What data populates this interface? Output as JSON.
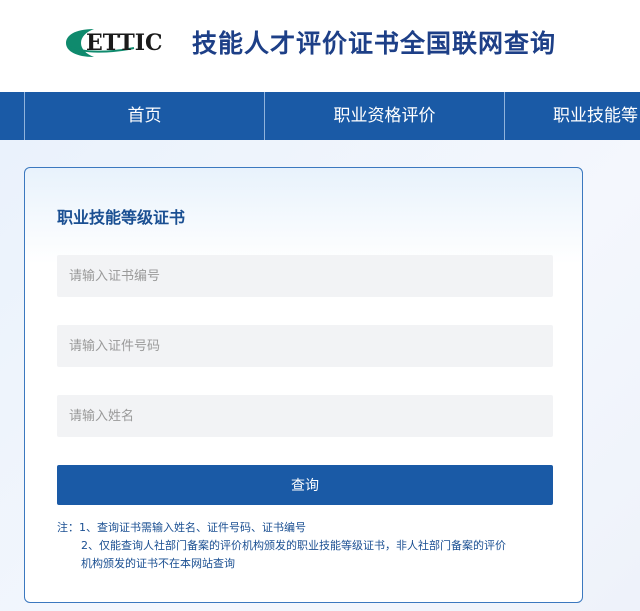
{
  "header": {
    "logo_text": "ETTIC",
    "site_title": "技能人才评价证书全国联网查询",
    "logo_color": "#0f8a6d",
    "title_color": "#1d3f87"
  },
  "nav": {
    "items": [
      {
        "label": "首页"
      },
      {
        "label": "职业资格评价"
      },
      {
        "label": "职业技能等"
      }
    ],
    "bg_color": "#1a5aa6"
  },
  "form": {
    "title": "职业技能等级证书",
    "cert_no_placeholder": "请输入证书编号",
    "id_no_placeholder": "请输入证件号码",
    "name_placeholder": "请输入姓名",
    "cert_no_value": "",
    "id_no_value": "",
    "name_value": "",
    "query_label": "查询"
  },
  "notes": {
    "line1": "注：1、查询证书需输入姓名、证件号码、证书编号",
    "line2": "2、仅能查询人社部门备案的评价机构颁发的职业技能等级证书，非人社部门备案的评价",
    "line3": "机构颁发的证书不在本网站查询"
  }
}
